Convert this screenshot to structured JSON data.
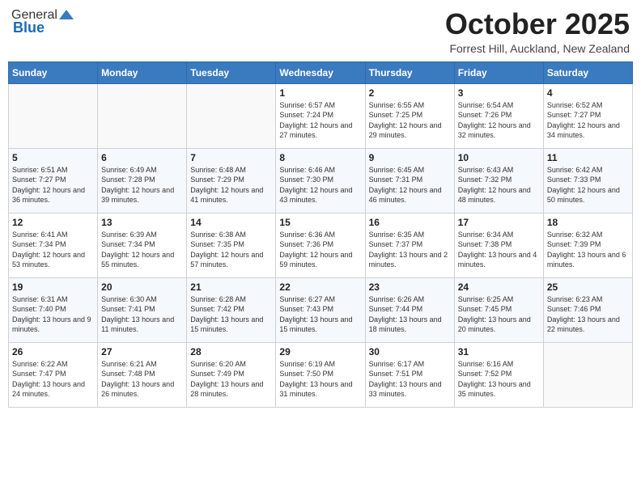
{
  "header": {
    "logo_general": "General",
    "logo_blue": "Blue",
    "month": "October 2025",
    "location": "Forrest Hill, Auckland, New Zealand"
  },
  "weekdays": [
    "Sunday",
    "Monday",
    "Tuesday",
    "Wednesday",
    "Thursday",
    "Friday",
    "Saturday"
  ],
  "weeks": [
    [
      {
        "day": "",
        "sunrise": "",
        "sunset": "",
        "daylight": ""
      },
      {
        "day": "",
        "sunrise": "",
        "sunset": "",
        "daylight": ""
      },
      {
        "day": "",
        "sunrise": "",
        "sunset": "",
        "daylight": ""
      },
      {
        "day": "1",
        "sunrise": "Sunrise: 6:57 AM",
        "sunset": "Sunset: 7:24 PM",
        "daylight": "Daylight: 12 hours and 27 minutes."
      },
      {
        "day": "2",
        "sunrise": "Sunrise: 6:55 AM",
        "sunset": "Sunset: 7:25 PM",
        "daylight": "Daylight: 12 hours and 29 minutes."
      },
      {
        "day": "3",
        "sunrise": "Sunrise: 6:54 AM",
        "sunset": "Sunset: 7:26 PM",
        "daylight": "Daylight: 12 hours and 32 minutes."
      },
      {
        "day": "4",
        "sunrise": "Sunrise: 6:52 AM",
        "sunset": "Sunset: 7:27 PM",
        "daylight": "Daylight: 12 hours and 34 minutes."
      }
    ],
    [
      {
        "day": "5",
        "sunrise": "Sunrise: 6:51 AM",
        "sunset": "Sunset: 7:27 PM",
        "daylight": "Daylight: 12 hours and 36 minutes."
      },
      {
        "day": "6",
        "sunrise": "Sunrise: 6:49 AM",
        "sunset": "Sunset: 7:28 PM",
        "daylight": "Daylight: 12 hours and 39 minutes."
      },
      {
        "day": "7",
        "sunrise": "Sunrise: 6:48 AM",
        "sunset": "Sunset: 7:29 PM",
        "daylight": "Daylight: 12 hours and 41 minutes."
      },
      {
        "day": "8",
        "sunrise": "Sunrise: 6:46 AM",
        "sunset": "Sunset: 7:30 PM",
        "daylight": "Daylight: 12 hours and 43 minutes."
      },
      {
        "day": "9",
        "sunrise": "Sunrise: 6:45 AM",
        "sunset": "Sunset: 7:31 PM",
        "daylight": "Daylight: 12 hours and 46 minutes."
      },
      {
        "day": "10",
        "sunrise": "Sunrise: 6:43 AM",
        "sunset": "Sunset: 7:32 PM",
        "daylight": "Daylight: 12 hours and 48 minutes."
      },
      {
        "day": "11",
        "sunrise": "Sunrise: 6:42 AM",
        "sunset": "Sunset: 7:33 PM",
        "daylight": "Daylight: 12 hours and 50 minutes."
      }
    ],
    [
      {
        "day": "12",
        "sunrise": "Sunrise: 6:41 AM",
        "sunset": "Sunset: 7:34 PM",
        "daylight": "Daylight: 12 hours and 53 minutes."
      },
      {
        "day": "13",
        "sunrise": "Sunrise: 6:39 AM",
        "sunset": "Sunset: 7:34 PM",
        "daylight": "Daylight: 12 hours and 55 minutes."
      },
      {
        "day": "14",
        "sunrise": "Sunrise: 6:38 AM",
        "sunset": "Sunset: 7:35 PM",
        "daylight": "Daylight: 12 hours and 57 minutes."
      },
      {
        "day": "15",
        "sunrise": "Sunrise: 6:36 AM",
        "sunset": "Sunset: 7:36 PM",
        "daylight": "Daylight: 12 hours and 59 minutes."
      },
      {
        "day": "16",
        "sunrise": "Sunrise: 6:35 AM",
        "sunset": "Sunset: 7:37 PM",
        "daylight": "Daylight: 13 hours and 2 minutes."
      },
      {
        "day": "17",
        "sunrise": "Sunrise: 6:34 AM",
        "sunset": "Sunset: 7:38 PM",
        "daylight": "Daylight: 13 hours and 4 minutes."
      },
      {
        "day": "18",
        "sunrise": "Sunrise: 6:32 AM",
        "sunset": "Sunset: 7:39 PM",
        "daylight": "Daylight: 13 hours and 6 minutes."
      }
    ],
    [
      {
        "day": "19",
        "sunrise": "Sunrise: 6:31 AM",
        "sunset": "Sunset: 7:40 PM",
        "daylight": "Daylight: 13 hours and 9 minutes."
      },
      {
        "day": "20",
        "sunrise": "Sunrise: 6:30 AM",
        "sunset": "Sunset: 7:41 PM",
        "daylight": "Daylight: 13 hours and 11 minutes."
      },
      {
        "day": "21",
        "sunrise": "Sunrise: 6:28 AM",
        "sunset": "Sunset: 7:42 PM",
        "daylight": "Daylight: 13 hours and 15 minutes."
      },
      {
        "day": "22",
        "sunrise": "Sunrise: 6:27 AM",
        "sunset": "Sunset: 7:43 PM",
        "daylight": "Daylight: 13 hours and 15 minutes."
      },
      {
        "day": "23",
        "sunrise": "Sunrise: 6:26 AM",
        "sunset": "Sunset: 7:44 PM",
        "daylight": "Daylight: 13 hours and 18 minutes."
      },
      {
        "day": "24",
        "sunrise": "Sunrise: 6:25 AM",
        "sunset": "Sunset: 7:45 PM",
        "daylight": "Daylight: 13 hours and 20 minutes."
      },
      {
        "day": "25",
        "sunrise": "Sunrise: 6:23 AM",
        "sunset": "Sunset: 7:46 PM",
        "daylight": "Daylight: 13 hours and 22 minutes."
      }
    ],
    [
      {
        "day": "26",
        "sunrise": "Sunrise: 6:22 AM",
        "sunset": "Sunset: 7:47 PM",
        "daylight": "Daylight: 13 hours and 24 minutes."
      },
      {
        "day": "27",
        "sunrise": "Sunrise: 6:21 AM",
        "sunset": "Sunset: 7:48 PM",
        "daylight": "Daylight: 13 hours and 26 minutes."
      },
      {
        "day": "28",
        "sunrise": "Sunrise: 6:20 AM",
        "sunset": "Sunset: 7:49 PM",
        "daylight": "Daylight: 13 hours and 28 minutes."
      },
      {
        "day": "29",
        "sunrise": "Sunrise: 6:19 AM",
        "sunset": "Sunset: 7:50 PM",
        "daylight": "Daylight: 13 hours and 31 minutes."
      },
      {
        "day": "30",
        "sunrise": "Sunrise: 6:17 AM",
        "sunset": "Sunset: 7:51 PM",
        "daylight": "Daylight: 13 hours and 33 minutes."
      },
      {
        "day": "31",
        "sunrise": "Sunrise: 6:16 AM",
        "sunset": "Sunset: 7:52 PM",
        "daylight": "Daylight: 13 hours and 35 minutes."
      },
      {
        "day": "",
        "sunrise": "",
        "sunset": "",
        "daylight": ""
      }
    ]
  ]
}
